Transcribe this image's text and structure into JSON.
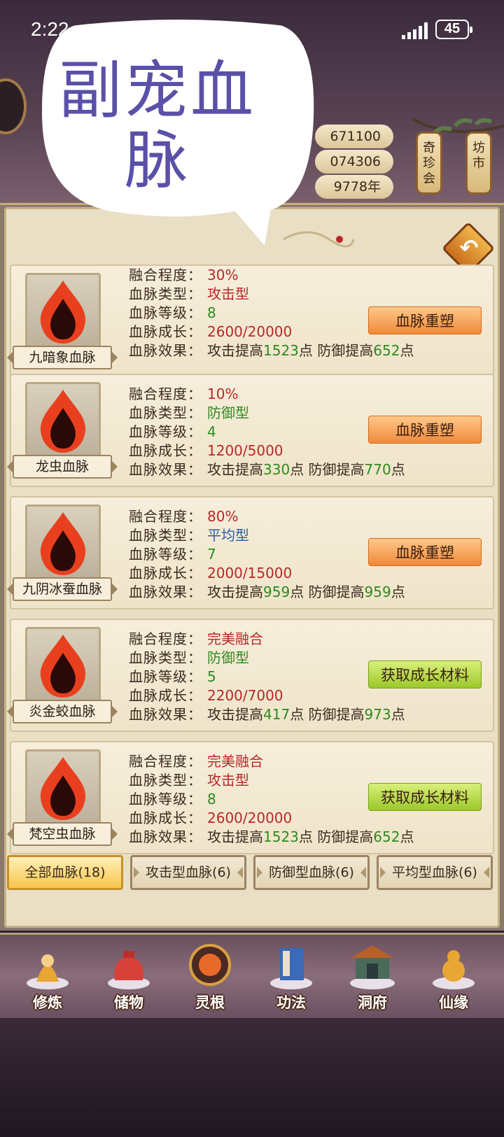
{
  "status": {
    "time": "2:22",
    "battery": "45"
  },
  "overlay": {
    "title": "副宠血脉"
  },
  "resources": {
    "r1": "671100",
    "r2": "074306",
    "r3": "9778年"
  },
  "top_buttons": {
    "qizhenhui": "奇珍会",
    "fangshi": "坊市"
  },
  "labels": {
    "fusion": "融合程度：",
    "type": "血脉类型：",
    "level": "血脉等级：",
    "growth": "血脉成长：",
    "effect": "血脉效果："
  },
  "bloodlines": [
    {
      "name": "九暗象血脉",
      "fusion": "30%",
      "type": "攻击型",
      "level": "8",
      "growth": "2600/20000",
      "atk_prefix": "攻击提高",
      "atk": "1523",
      "unit": "点",
      "def_prefix": "防御提高",
      "def": "652",
      "action": "血脉重塑"
    },
    {
      "name": "龙虫血脉",
      "fusion": "10%",
      "type": "防御型",
      "level": "4",
      "growth": "1200/5000",
      "atk_prefix": "攻击提高",
      "atk": "330",
      "unit": "点",
      "def_prefix": "防御提高",
      "def": "770",
      "action": "血脉重塑"
    },
    {
      "name": "九阴冰蚕血脉",
      "fusion": "80%",
      "type": "平均型",
      "level": "7",
      "growth": "2000/15000",
      "atk_prefix": "攻击提高",
      "atk": "959",
      "unit": "点",
      "def_prefix": "防御提高",
      "def": "959",
      "action": "血脉重塑"
    },
    {
      "name": "炎金蛟血脉",
      "fusion": "完美融合",
      "type": "防御型",
      "level": "5",
      "growth": "2200/7000",
      "atk_prefix": "攻击提高",
      "atk": "417",
      "unit": "点",
      "def_prefix": "防御提高",
      "def": "973",
      "action": "获取成长材料"
    },
    {
      "name": "梵空虫血脉",
      "fusion": "完美融合",
      "type": "攻击型",
      "level": "8",
      "growth": "2600/20000",
      "atk_prefix": "攻击提高",
      "atk": "1523",
      "unit": "点",
      "def_prefix": "防御提高",
      "def": "652",
      "action": "获取成长材料"
    }
  ],
  "tabs": [
    {
      "label": "全部血脉(18)",
      "active": true
    },
    {
      "label": "攻击型血脉(6)",
      "active": false
    },
    {
      "label": "防御型血脉(6)",
      "active": false
    },
    {
      "label": "平均型血脉(6)",
      "active": false
    }
  ],
  "nav": [
    {
      "label": "修炼",
      "icon": "cultivation-icon"
    },
    {
      "label": "储物",
      "icon": "storage-bag-icon"
    },
    {
      "label": "灵根",
      "icon": "spirit-root-icon"
    },
    {
      "label": "功法",
      "icon": "technique-book-icon"
    },
    {
      "label": "洞府",
      "icon": "cave-dwelling-icon"
    },
    {
      "label": "仙缘",
      "icon": "immortal-fate-icon"
    }
  ],
  "colors": {
    "red": "#b8282a",
    "green": "#2e8a1f",
    "blue": "#2a5ea8",
    "orange_btn": "#ef8a3a",
    "green_btn": "#9cc82a"
  }
}
